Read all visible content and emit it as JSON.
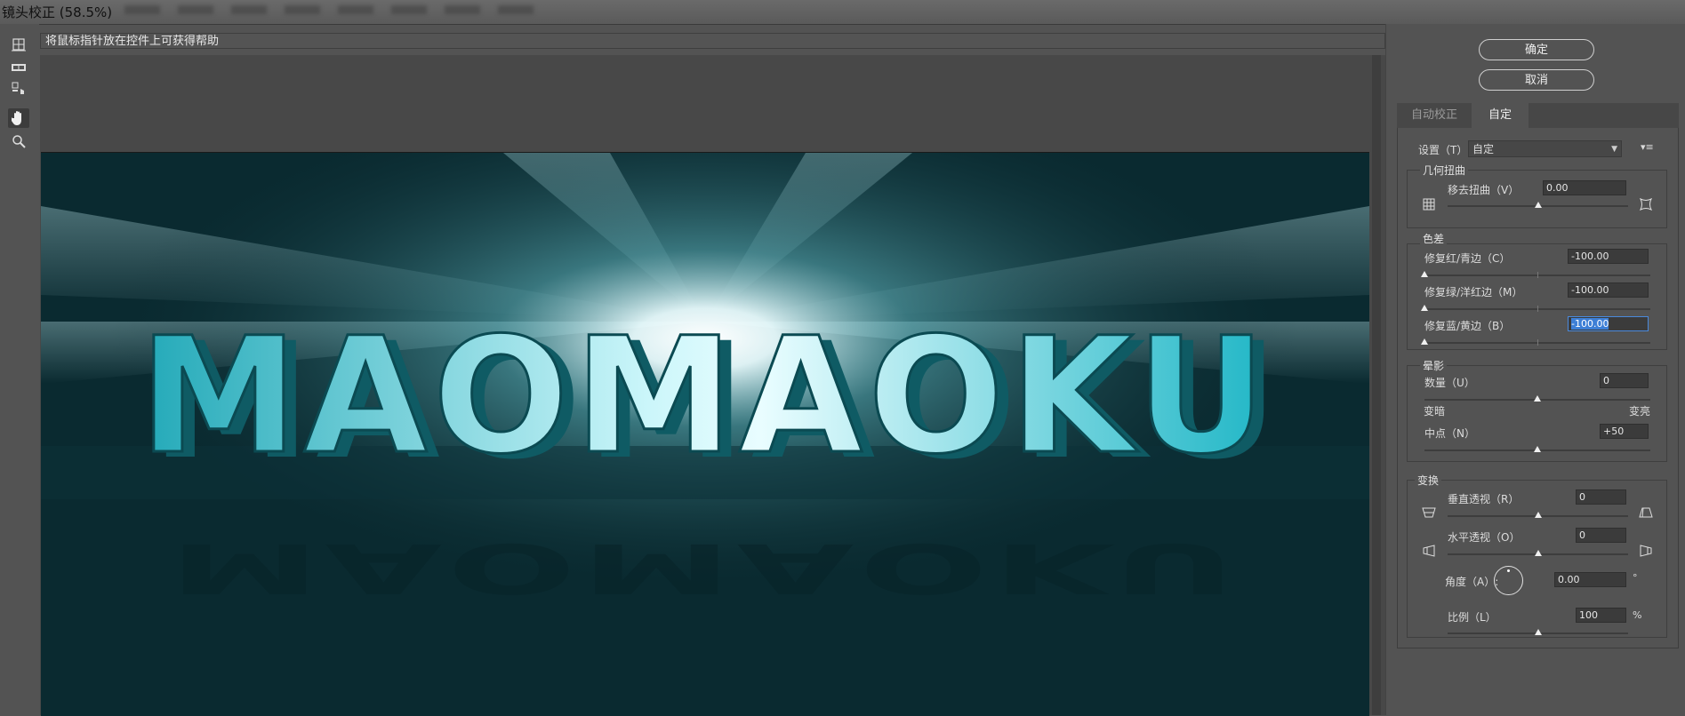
{
  "window": {
    "title": "镜头校正 (58.5%)"
  },
  "hint": "将鼠标指针放在控件上可获得帮助",
  "photo": {
    "text": "MAOMAOKU"
  },
  "buttons": {
    "ok": "确定",
    "cancel": "取消"
  },
  "tabs": [
    {
      "label": "自动校正",
      "active": false
    },
    {
      "label": "自定",
      "active": true
    }
  ],
  "settings": {
    "label": "设置（T）:",
    "value": "自定"
  },
  "geometric": {
    "title": "几何扭曲",
    "remove_distortion": {
      "label": "移去扭曲（V）",
      "value": "0.00",
      "level": 0.5
    }
  },
  "chromatic": {
    "title": "色差",
    "red_cyan": {
      "label": "修复红/青边（C）",
      "value": "-100.00",
      "level": 0
    },
    "green_magenta": {
      "label": "修复绿/洋红边（M）",
      "value": "-100.00",
      "level": 0
    },
    "blue_yellow": {
      "label": "修复蓝/黄边（B）",
      "value": "-100.00",
      "level": 0
    }
  },
  "vignette": {
    "title": "晕影",
    "amount": {
      "label": "数量（U）",
      "value": "0",
      "level": 0.5
    },
    "darken": "变暗",
    "lighten": "变亮",
    "midpoint": {
      "label": "中点（N）",
      "value": "+50",
      "level": 0.5
    }
  },
  "transform": {
    "title": "变换",
    "vertical": {
      "label": "垂直透视（R）",
      "value": "0",
      "level": 0.5
    },
    "horizontal": {
      "label": "水平透视（O）",
      "value": "0",
      "level": 0.5
    },
    "angle": {
      "label": "角度（A）:",
      "value": "0.00",
      "unit": "°"
    },
    "scale": {
      "label": "比例（L）",
      "value": "100",
      "unit": "%",
      "level": 0.5
    }
  },
  "colors": {
    "cyan": "#1fb6c6",
    "bg": "#0a2a30",
    "panel": "#535353"
  }
}
